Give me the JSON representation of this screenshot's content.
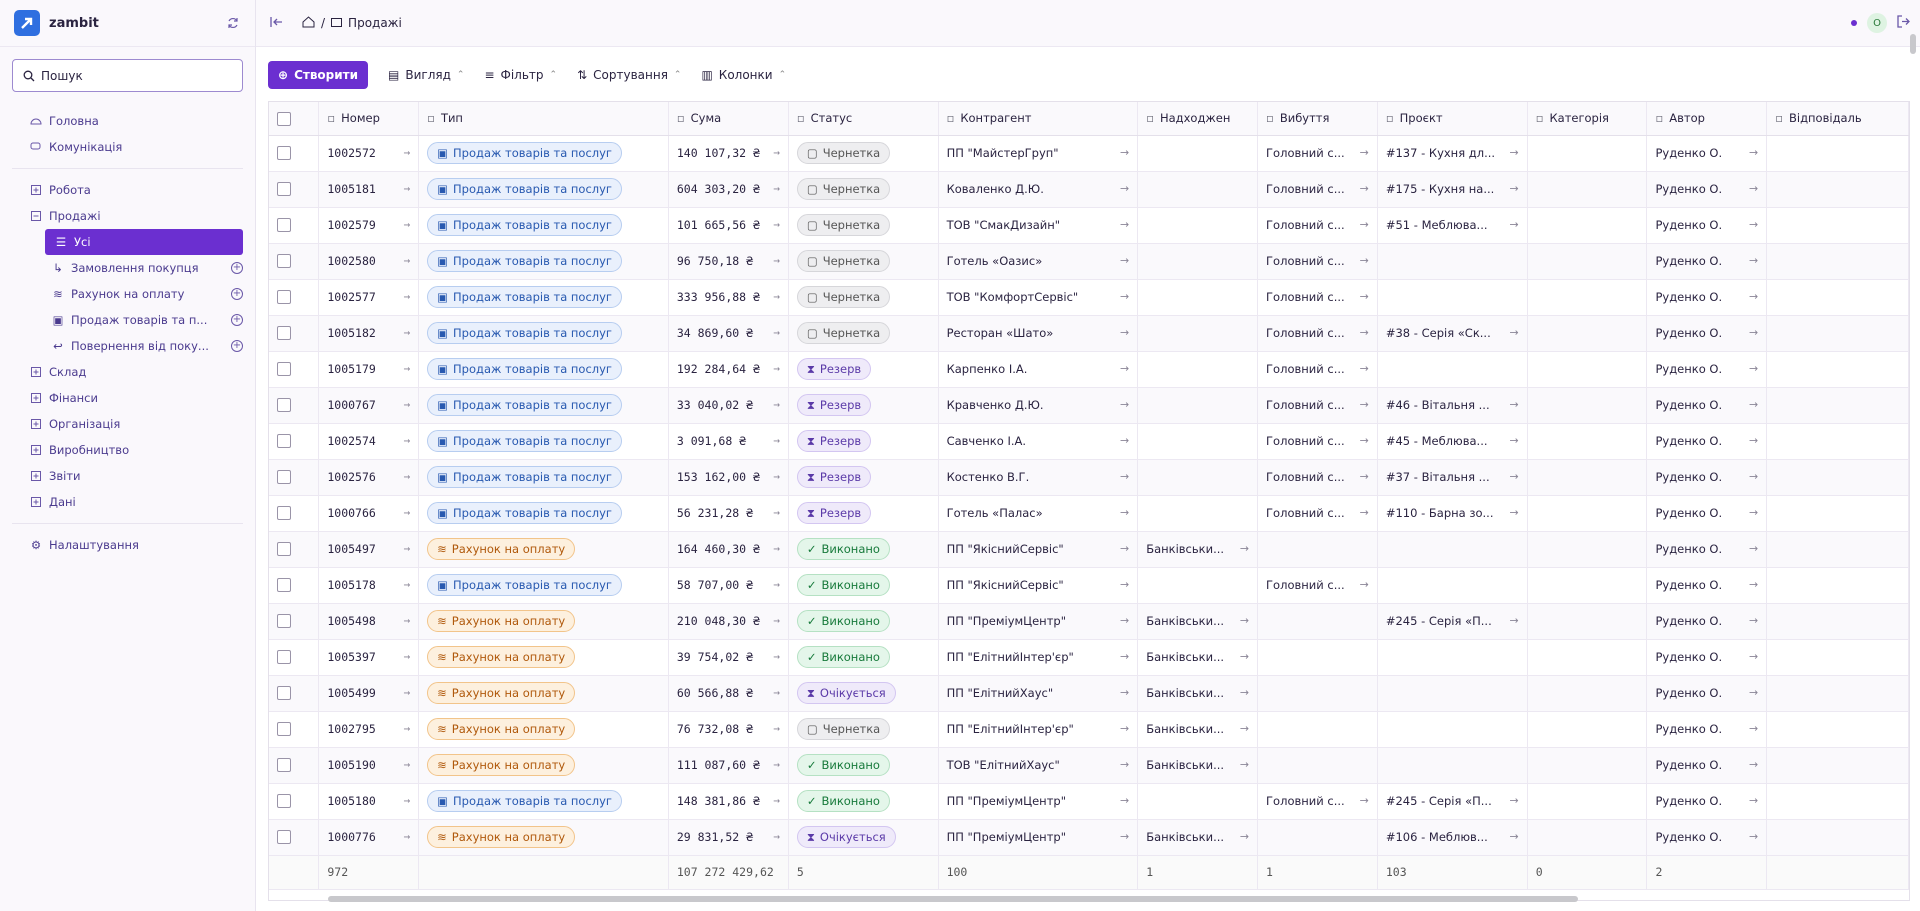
{
  "app": {
    "name": "zambit"
  },
  "search": {
    "label": "Пошук"
  },
  "nav": {
    "top": [
      {
        "label": "Головна"
      },
      {
        "label": "Комунікація"
      }
    ],
    "sections": [
      {
        "label": "Робота"
      },
      {
        "label": "Продажі"
      }
    ],
    "sales_sub": [
      {
        "label": "Усі"
      },
      {
        "label": "Замовлення покупця"
      },
      {
        "label": "Рахунок на оплату"
      },
      {
        "label": "Продаж товарів та п..."
      },
      {
        "label": "Повернення від поку..."
      }
    ],
    "more": [
      {
        "label": "Склад"
      },
      {
        "label": "Фінанси"
      },
      {
        "label": "Організація"
      },
      {
        "label": "Виробництво"
      },
      {
        "label": "Звіти"
      },
      {
        "label": "Дані"
      }
    ],
    "settings": "Налаштування"
  },
  "breadcrumb": {
    "page": "Продажі"
  },
  "user": {
    "initial": "О"
  },
  "toolbar": {
    "create": "Створити",
    "view": "Вигляд",
    "filter": "Фільтр",
    "sort": "Сортування",
    "columns": "Колонки"
  },
  "columns": [
    "Номер",
    "Тип",
    "Сума",
    "Статус",
    "Контрагент",
    "Надходжен",
    "Вибуття",
    "Проєкт",
    "Категорія",
    "Автор",
    "Відповідаль"
  ],
  "rows": [
    {
      "num": "1002572",
      "type": "Продаж товарів та послуг",
      "t": "sale",
      "sum": "140 107,32 ₴",
      "status": "Чернетка",
      "s": "draft",
      "party": "ПП \"МайстерГруп\"",
      "in": "",
      "out": "Головний с...",
      "project": "#137 - Кухня дл...",
      "author": "Руденко О."
    },
    {
      "num": "1005181",
      "type": "Продаж товарів та послуг",
      "t": "sale",
      "sum": "604 303,20 ₴",
      "status": "Чернетка",
      "s": "draft",
      "party": "Коваленко Д.Ю.",
      "in": "",
      "out": "Головний с...",
      "project": "#175 - Кухня на...",
      "author": "Руденко О."
    },
    {
      "num": "1002579",
      "type": "Продаж товарів та послуг",
      "t": "sale",
      "sum": "101 665,56 ₴",
      "status": "Чернетка",
      "s": "draft",
      "party": "ТОВ \"СмакДизайн\"",
      "in": "",
      "out": "Головний с...",
      "project": "#51 - Меблюва...",
      "author": "Руденко О."
    },
    {
      "num": "1002580",
      "type": "Продаж товарів та послуг",
      "t": "sale",
      "sum": "96 750,18 ₴",
      "status": "Чернетка",
      "s": "draft",
      "party": "Готель «Оазис»",
      "in": "",
      "out": "Головний с...",
      "project": "",
      "author": "Руденко О."
    },
    {
      "num": "1002577",
      "type": "Продаж товарів та послуг",
      "t": "sale",
      "sum": "333 956,88 ₴",
      "status": "Чернетка",
      "s": "draft",
      "party": "ТОВ \"КомфортСервіс\"",
      "in": "",
      "out": "Головний с...",
      "project": "",
      "author": "Руденко О."
    },
    {
      "num": "1005182",
      "type": "Продаж товарів та послуг",
      "t": "sale",
      "sum": "34 869,60 ₴",
      "status": "Чернетка",
      "s": "draft",
      "party": "Ресторан «Шато»",
      "in": "",
      "out": "Головний с...",
      "project": "#38 - Серія «Ск...",
      "author": "Руденко О."
    },
    {
      "num": "1005179",
      "type": "Продаж товарів та послуг",
      "t": "sale",
      "sum": "192 284,64 ₴",
      "status": "Резерв",
      "s": "reserve",
      "party": "Карпенко І.А.",
      "in": "",
      "out": "Головний с...",
      "project": "",
      "author": "Руденко О."
    },
    {
      "num": "1000767",
      "type": "Продаж товарів та послуг",
      "t": "sale",
      "sum": "33 040,02 ₴",
      "status": "Резерв",
      "s": "reserve",
      "party": "Кравченко Д.Ю.",
      "in": "",
      "out": "Головний с...",
      "project": "#46 - Вітальня ...",
      "author": "Руденко О."
    },
    {
      "num": "1002574",
      "type": "Продаж товарів та послуг",
      "t": "sale",
      "sum": "3 091,68 ₴",
      "status": "Резерв",
      "s": "reserve",
      "party": "Савченко І.А.",
      "in": "",
      "out": "Головний с...",
      "project": "#45 - Меблюва...",
      "author": "Руденко О."
    },
    {
      "num": "1002576",
      "type": "Продаж товарів та послуг",
      "t": "sale",
      "sum": "153 162,00 ₴",
      "status": "Резерв",
      "s": "reserve",
      "party": "Костенко В.Г.",
      "in": "",
      "out": "Головний с...",
      "project": "#37 - Вітальня ...",
      "author": "Руденко О."
    },
    {
      "num": "1000766",
      "type": "Продаж товарів та послуг",
      "t": "sale",
      "sum": "56 231,28 ₴",
      "status": "Резерв",
      "s": "reserve",
      "party": "Готель «Палас»",
      "in": "",
      "out": "Головний с...",
      "project": "#110 - Барна зо...",
      "author": "Руденко О."
    },
    {
      "num": "1005497",
      "type": "Рахунок на оплату",
      "t": "invoice",
      "sum": "164 460,30 ₴",
      "status": "Виконано",
      "s": "done",
      "party": "ПП \"ЯкіснийСервіс\"",
      "in": "Банківськи...",
      "out": "",
      "project": "",
      "author": "Руденко О."
    },
    {
      "num": "1005178",
      "type": "Продаж товарів та послуг",
      "t": "sale",
      "sum": "58 707,00 ₴",
      "status": "Виконано",
      "s": "done",
      "party": "ПП \"ЯкіснийСервіс\"",
      "in": "",
      "out": "Головний с...",
      "project": "",
      "author": "Руденко О."
    },
    {
      "num": "1005498",
      "type": "Рахунок на оплату",
      "t": "invoice",
      "sum": "210 048,30 ₴",
      "status": "Виконано",
      "s": "done",
      "party": "ПП \"ПреміумЦентр\"",
      "in": "Банківськи...",
      "out": "",
      "project": "#245 - Серія «П...",
      "author": "Руденко О."
    },
    {
      "num": "1005397",
      "type": "Рахунок на оплату",
      "t": "invoice",
      "sum": "39 754,02 ₴",
      "status": "Виконано",
      "s": "done",
      "party": "ПП \"ЕлітнийІнтер'єр\"",
      "in": "Банківськи...",
      "out": "",
      "project": "",
      "author": "Руденко О."
    },
    {
      "num": "1005499",
      "type": "Рахунок на оплату",
      "t": "invoice",
      "sum": "60 566,88 ₴",
      "status": "Очікується",
      "s": "wait",
      "party": "ПП \"ЕлітнийХаус\"",
      "in": "Банківськи...",
      "out": "",
      "project": "",
      "author": "Руденко О."
    },
    {
      "num": "1002795",
      "type": "Рахунок на оплату",
      "t": "invoice",
      "sum": "76 732,08 ₴",
      "status": "Чернетка",
      "s": "draft",
      "party": "ПП \"ЕлітнийІнтер'єр\"",
      "in": "Банківськи...",
      "out": "",
      "project": "",
      "author": "Руденко О."
    },
    {
      "num": "1005190",
      "type": "Рахунок на оплату",
      "t": "invoice",
      "sum": "111 087,60 ₴",
      "status": "Виконано",
      "s": "done",
      "party": "ТОВ \"ЕлітнийХаус\"",
      "in": "Банківськи...",
      "out": "",
      "project": "",
      "author": "Руденко О."
    },
    {
      "num": "1005180",
      "type": "Продаж товарів та послуг",
      "t": "sale",
      "sum": "148 381,86 ₴",
      "status": "Виконано",
      "s": "done",
      "party": "ПП \"ПреміумЦентр\"",
      "in": "",
      "out": "Головний с...",
      "project": "#245 - Серія «П...",
      "author": "Руденко О."
    },
    {
      "num": "1000776",
      "type": "Рахунок на оплату",
      "t": "invoice",
      "sum": "29 831,52 ₴",
      "status": "Очікується",
      "s": "wait",
      "party": "ПП \"ПреміумЦентр\"",
      "in": "Банківськи...",
      "out": "",
      "project": "#106 - Меблюв...",
      "author": "Руденко О."
    }
  ],
  "footer": {
    "count": "972",
    "sum": "107 272 429,62",
    "status": "5",
    "party": "100",
    "in": "1",
    "out": "1",
    "project": "103",
    "category": "0",
    "author": "2"
  }
}
